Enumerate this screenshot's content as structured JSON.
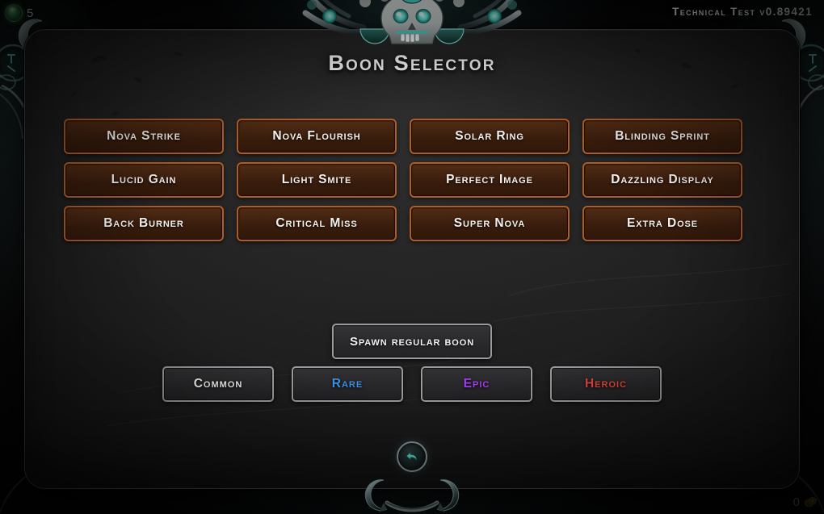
{
  "hud": {
    "top_left": {
      "icon": "green-orb-icon",
      "count": "5"
    },
    "bottom_right": {
      "icon": "coin-icon",
      "count": "0"
    },
    "version": "Technical Test v0.89421"
  },
  "panel": {
    "title": "Boon Selector"
  },
  "boons": [
    {
      "label": "Nova Strike"
    },
    {
      "label": "Nova Flourish"
    },
    {
      "label": "Solar Ring"
    },
    {
      "label": "Blinding Sprint"
    },
    {
      "label": "Lucid Gain"
    },
    {
      "label": "Light Smite"
    },
    {
      "label": "Perfect Image"
    },
    {
      "label": "Dazzling Display"
    },
    {
      "label": "Back Burner"
    },
    {
      "label": "Critical Miss"
    },
    {
      "label": "Super Nova"
    },
    {
      "label": "Extra Dose"
    }
  ],
  "spawn": {
    "label": "Spawn regular boon"
  },
  "rarities": [
    {
      "label": "Common",
      "color": "#f2f2f3"
    },
    {
      "label": "Rare",
      "color": "#3a8fe0"
    },
    {
      "label": "Epic",
      "color": "#a13df0"
    },
    {
      "label": "Heroic",
      "color": "#e2453f"
    }
  ],
  "back": {
    "icon": "back-arrow-icon"
  },
  "theme": {
    "boon_border": "#b05c22",
    "boon_fill": "#3a1d0d",
    "neutral_border": "#9b9b9e",
    "panel_bg": "#242425",
    "accent_teal": "#7fd8d2"
  }
}
